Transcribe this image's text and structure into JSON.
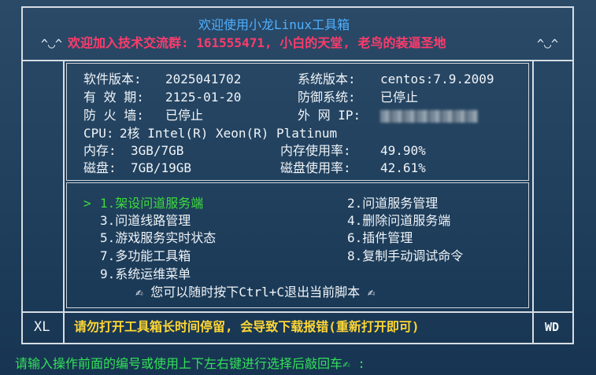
{
  "header": {
    "title": "欢迎使用小龙Linux工具箱",
    "left_deco": "^◡^",
    "right_deco": "^◡^",
    "promo": "欢迎加入技术交流群: 161555471, 小白的天堂, 老鸟的装逼圣地"
  },
  "info": {
    "software_version_label": "软件版本:",
    "software_version_value": "2025041702",
    "system_version_label": "系统版本:",
    "system_version_value": "centos:7.9.2009",
    "expiry_label": "有 效 期:",
    "expiry_value": "2125-01-20",
    "defense_label": "防御系统:",
    "defense_value": "已停止",
    "firewall_label": "防 火 墙:",
    "firewall_value": "已停止",
    "external_ip_label": "外 网 IP:",
    "cpu_label": "CPU:",
    "cpu_value": "2核 Intel(R) Xeon(R) Platinum",
    "memory_label": "内存:",
    "memory_value": "3GB/7GB",
    "memory_usage_label": "内存使用率:",
    "memory_usage_value": "49.90%",
    "disk_label": "磁盘:",
    "disk_value": "7GB/19GB",
    "disk_usage_label": "磁盘使用率:",
    "disk_usage_value": "42.61%"
  },
  "menu": {
    "items": [
      {
        "label": "1.架设问道服务端"
      },
      {
        "label": "2.问道服务管理"
      },
      {
        "label": "3.问道线路管理"
      },
      {
        "label": "4.删除问道服务端"
      },
      {
        "label": "5.游戏服务实时状态"
      },
      {
        "label": "6.插件管理"
      },
      {
        "label": "7.多功能工具箱"
      },
      {
        "label": "8.复制手动调试命令"
      },
      {
        "label": "9.系统运维菜单"
      }
    ],
    "cursor": ">",
    "exit_hint": "✍ 您可以随时按下Ctrl+C退出当前脚本 ✍"
  },
  "footer": {
    "left_logo": "XL",
    "right_logo": "WD",
    "warning": "请勿打开工具箱长时间停留, 会导致下载报错(重新打开即可)"
  },
  "prompt": {
    "text": "请输入操作前面的编号或使用上下左右键进行选择后敲回车✍ :"
  }
}
